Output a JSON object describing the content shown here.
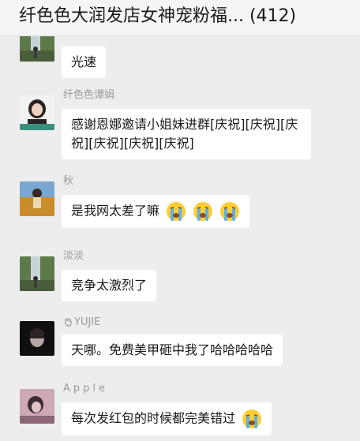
{
  "window": {
    "title": "纤色色大润发店女神宠粉福... (412)"
  },
  "messages": [
    {
      "sender": "",
      "text": "光速"
    },
    {
      "sender": "纤色色谭娟",
      "text": "感谢恩娜邀请小姐妹进群[庆祝][庆祝][庆祝][庆祝][庆祝][庆祝]"
    },
    {
      "sender": "秋",
      "text": "是我网太差了嘛",
      "emojis": [
        "crying-face",
        "crying-face",
        "crying-face"
      ]
    },
    {
      "sender": "淡淡",
      "text": "竞争太激烈了"
    },
    {
      "sender": "YUJIE",
      "text": "天哪。免费美甲砸中我了哈哈哈哈哈"
    },
    {
      "sender": "Apple",
      "text": "每次发红包的时候都完美错过",
      "emojis": [
        "crying-face"
      ]
    }
  ],
  "colors": {
    "background": "#ededed",
    "bubble": "#ffffff",
    "name_text": "#9a9a9a",
    "title_text": "#1a1a1a"
  }
}
